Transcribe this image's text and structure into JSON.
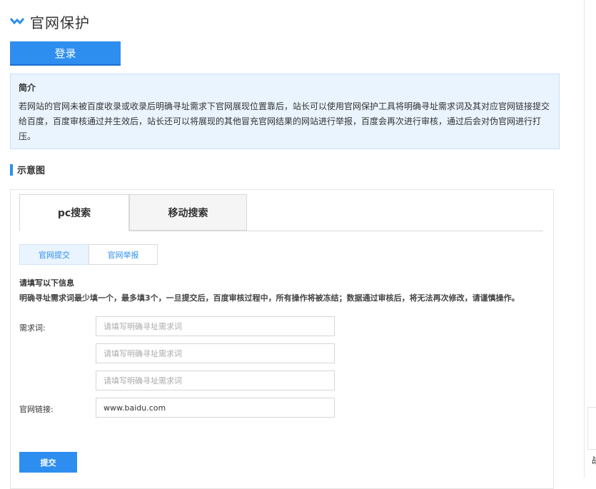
{
  "page": {
    "title": "官网保护",
    "login_label": "登录"
  },
  "intro": {
    "title": "简介",
    "text": "若网站的官网未被百度收录或收录后明确寻址需求下官网展现位置靠后，站长可以使用官网保护工具将明确寻址需求词及其对应官网链接提交给百度，百度审核通过并生效后，站长还可以将展现的其他冒充官网结果的网站进行举报，百度会再次进行审核，通过后会对伪官网进行打压。"
  },
  "section": {
    "title": "示意图"
  },
  "tabs": [
    {
      "label": "pc搜索",
      "active": true
    },
    {
      "label": "移动搜索",
      "active": false
    }
  ],
  "subtabs": [
    {
      "label": "官网提交",
      "active": true
    },
    {
      "label": "官网举报",
      "active": false
    }
  ],
  "form": {
    "title": "请填写以下信息",
    "note": "明确寻址需求词最少填一个，最多填3个，一旦提交后，百度审核过程中，所有操作将被冻结；数据通过审核后，将无法再次修改，请谨慎操作。",
    "keywords_label": "需求词:",
    "keyword_placeholder": "请填写明确寻址需求词",
    "url_label": "官网链接:",
    "url_value": "www.baidu.com",
    "submit_label": "提交"
  },
  "right_edge": {
    "partial_char": "敁"
  },
  "colors": {
    "accent": "#2e8ef0",
    "intro_bg": "#eaf4fe",
    "intro_border": "#c6dff6"
  }
}
